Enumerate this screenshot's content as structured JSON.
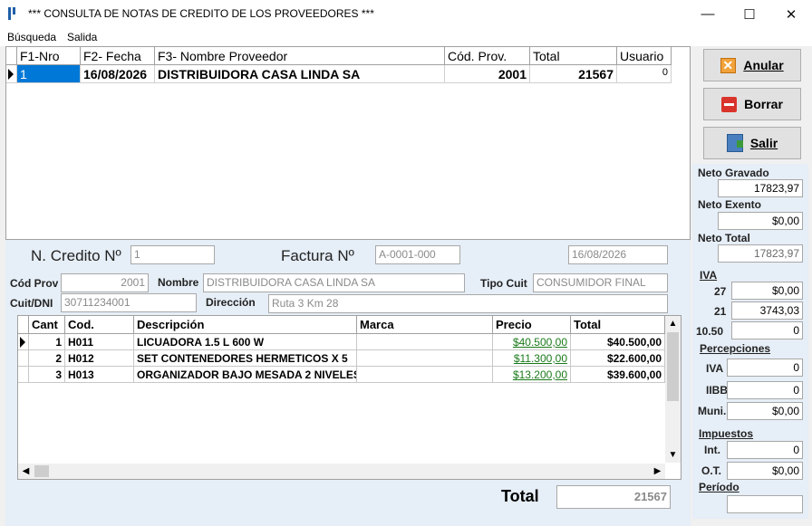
{
  "window": {
    "title": "***  CONSULTA DE NOTAS DE CREDITO DE LOS PROVEEDORES ***",
    "minimize": "—",
    "maximize": "☐",
    "close": "✕"
  },
  "menu": [
    "Búsqueda",
    "Salida"
  ],
  "grid": {
    "headers": [
      "F1-Nro",
      "F2- Fecha",
      "F3- Nombre Proveedor",
      "Cód. Prov.",
      "Total",
      "Usuario"
    ],
    "row": {
      "nro": "1",
      "fecha": "16/08/2026",
      "proveedor": "DISTRIBUIDORA CASA LINDA SA",
      "cod_prov": "2001",
      "total": "21567",
      "usuario": "0"
    }
  },
  "form": {
    "n_credito_label": "N. Credito Nº",
    "n_credito": "1",
    "factura_label": "Factura Nº",
    "factura": "A-0001-000",
    "fecha": "16/08/2026",
    "cod_prov_label": "Cód Prov",
    "cod_prov": "2001",
    "nombre_label": "Nombre",
    "nombre": "DISTRIBUIDORA CASA LINDA SA",
    "tipo_cuit_label": "Tipo Cuit",
    "tipo_cuit": "CONSUMIDOR FINAL",
    "cuit_label": "Cuit/DNI",
    "cuit": "30711234001",
    "direccion_label": "Dirección",
    "direccion": "Ruta 3 Km 28"
  },
  "items": {
    "headers": [
      "Cant",
      "Cod.",
      "Descripción",
      "Marca",
      "Precio",
      "Total"
    ],
    "rows": [
      {
        "cant": "1",
        "cod": "H011",
        "desc": "LICUADORA 1.5 L 600 W",
        "marca": "",
        "precio": "$40.500,00",
        "total": "$40.500,00"
      },
      {
        "cant": "2",
        "cod": "H012",
        "desc": "SET CONTENEDORES HERMETICOS X 5",
        "marca": "",
        "precio": "$11.300,00",
        "total": "$22.600,00"
      },
      {
        "cant": "3",
        "cod": "H013",
        "desc": "ORGANIZADOR BAJO MESADA 2 NIVELES",
        "marca": "",
        "precio": "$13.200,00",
        "total": "$39.600,00"
      }
    ]
  },
  "total_label": "Total",
  "total": "21567",
  "buttons": {
    "anular": "Anular",
    "borrar": "Borrar",
    "salir": "Salir"
  },
  "summary": {
    "neto_gravado_label": "Neto Gravado",
    "neto_gravado": "17823,97",
    "neto_exento_label": "Neto Exento",
    "neto_exento": "$0,00",
    "neto_total_label": "Neto Total",
    "neto_total": "17823,97",
    "iva_label": "IVA",
    "iva27_label": "27",
    "iva27": "$0,00",
    "iva21_label": "21",
    "iva21": "3743,03",
    "iva105_label": "10.50",
    "iva105": "0",
    "percepciones_label": "Percepciones",
    "p_iva_label": "IVA",
    "p_iva": "0",
    "p_iibb_label": "IIBB",
    "p_iibb": "0",
    "p_muni_label": "Muni.",
    "p_muni": "$0,00",
    "impuestos_label": "Impuestos",
    "int_label": "Int.",
    "int": "0",
    "ot_label": "O.T.",
    "ot": "$0,00",
    "periodo_label": "Período",
    "periodo": ""
  },
  "colors": {
    "panel": "#e6eef7",
    "link": "#1a7a1a"
  }
}
